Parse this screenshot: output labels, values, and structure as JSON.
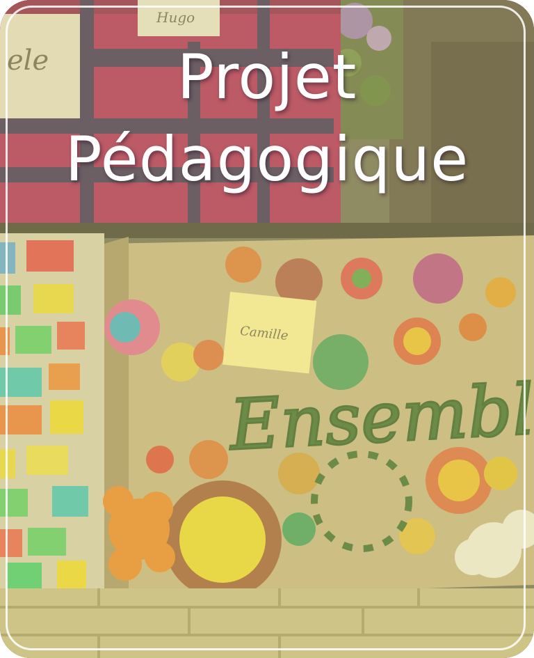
{
  "card": {
    "title_line1": "Projet",
    "title_line2": "Pédagogique"
  },
  "photo": {
    "word": "Ensemble",
    "sticky_note": "Camille",
    "top_note": "Hugo",
    "left_note": "ele"
  },
  "colors": {
    "overlay_tint": "#d8cf7a",
    "title_text": "#ffffff",
    "frame": "#ffffff",
    "box_magenta": "#b0245e",
    "box_cardboard": "#c9b58a"
  }
}
